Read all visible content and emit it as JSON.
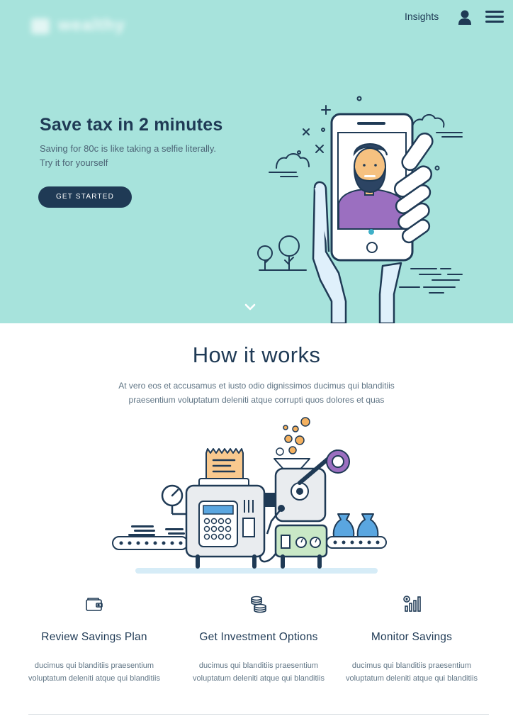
{
  "header": {
    "logo_text": "wealthy",
    "nav_link": "Insights",
    "icons": {
      "user": "user-icon",
      "menu": "hamburger-menu-icon"
    }
  },
  "hero": {
    "title": "Save tax in 2 minutes",
    "subtitle": "Saving for 80c is like taking a selfie literally. Try it for yourself",
    "cta": "GET STARTED",
    "scroll_icon": "chevron-down-icon",
    "illustration": "hand-holding-phone-selfie-illustration"
  },
  "how": {
    "title": "How it works",
    "description": "At vero eos et accusamus et iusto odio dignissimos ducimus qui blanditiis praesentium voluptatum deleniti atque corrupti quos dolores et quas",
    "illustration": "savings-machine-illustration"
  },
  "features": [
    {
      "icon": "wallet-icon",
      "title": "Review Savings Plan",
      "text": "ducimus qui blanditiis praesentium voluptatum deleniti atque qui blanditiis"
    },
    {
      "icon": "coins-stack-icon",
      "title": "Get Investment Options",
      "text": "ducimus qui blanditiis praesentium voluptatum deleniti atque qui blanditiis"
    },
    {
      "icon": "growth-chart-icon",
      "title": "Monitor Savings",
      "text": "ducimus qui blanditiis praesentium voluptatum deleniti atque  qui blanditiis"
    }
  ],
  "colors": {
    "hero_bg": "#a7e3dc",
    "navy": "#1f3a55",
    "purple": "#9b6fc0",
    "orange": "#f4b160",
    "skin": "#f6c180",
    "green_panel": "#c9e8c6"
  }
}
